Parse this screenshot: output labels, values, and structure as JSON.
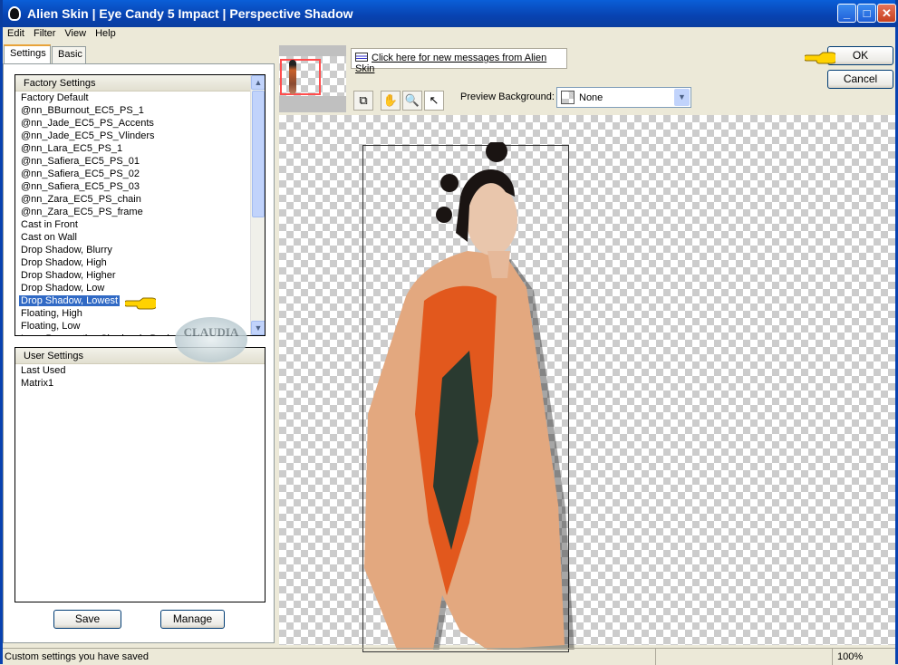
{
  "window": {
    "title": "Alien Skin | Eye Candy 5 Impact | Perspective Shadow"
  },
  "menu": [
    "Edit",
    "Filter",
    "View",
    "Help"
  ],
  "tabs": [
    {
      "label": "Settings",
      "active": true
    },
    {
      "label": "Basic",
      "active": false
    }
  ],
  "factory_settings": {
    "header": "Factory Settings",
    "items": [
      "Factory Default",
      "@nn_BBurnout_EC5_PS_1",
      "@nn_Jade_EC5_PS_Accents",
      "@nn_Jade_EC5_PS_Vlinders",
      "@nn_Lara_EC5_PS_1",
      "@nn_Safiera_EC5_PS_01",
      "@nn_Safiera_EC5_PS_02",
      "@nn_Safiera_EC5_PS_03",
      "@nn_Zara_EC5_PS_chain",
      "@nn_Zara_EC5_PS_frame",
      "Cast in Front",
      "Cast on Wall",
      "Drop Shadow, Blurry",
      "Drop Shadow, High",
      "Drop Shadow, Higher",
      "Drop Shadow, Low",
      "Drop Shadow, Lowest",
      "Floating, High",
      "Floating, Low",
      "Long Perspective Shadow in Back"
    ],
    "selected": "Drop Shadow, Lowest"
  },
  "user_settings": {
    "header": "User Settings",
    "items": [
      "Last Used",
      "Matrix1"
    ]
  },
  "buttons": {
    "save": "Save",
    "manage": "Manage",
    "ok": "OK",
    "cancel": "Cancel"
  },
  "messages_link": "Click here for new messages from Alien Skin",
  "preview_background": {
    "label": "Preview Background:",
    "value": "None"
  },
  "watermark": "CLAUDIA",
  "status": {
    "text": "Custom settings you have saved",
    "zoom": "100%"
  },
  "colors": {
    "titlebar": "#0842b0",
    "selection": "#316ac5",
    "thumbnail_frame": "#ff4d4d"
  }
}
